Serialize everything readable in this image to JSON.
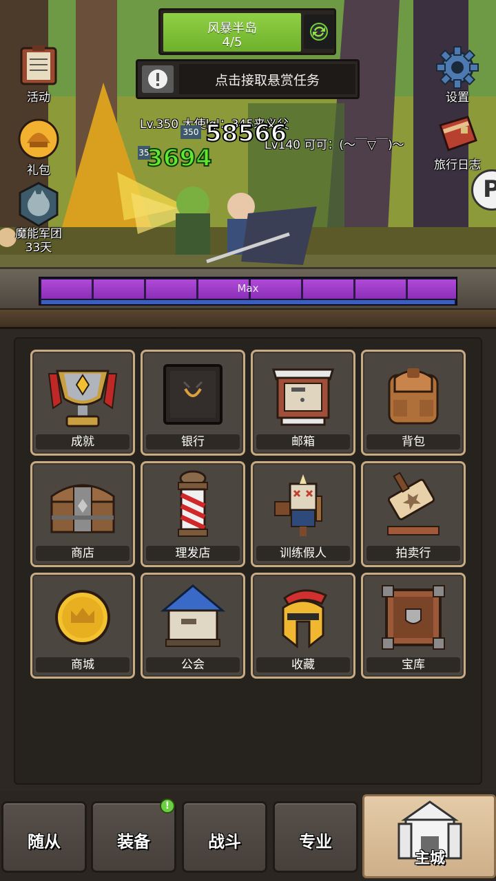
{
  "stage": {
    "name": "风暴半岛",
    "progress": "4/5"
  },
  "quest": {
    "text": "点击接取悬赏任务"
  },
  "left_icons": [
    {
      "label": "活动",
      "icon": "event-board-icon"
    },
    {
      "label": "礼包",
      "icon": "gift-helmet-icon"
    },
    {
      "label": "魔能军团",
      "icon": "wolf-emblem-icon",
      "sub": "33天"
    }
  ],
  "right_icons": [
    {
      "label": "设置",
      "icon": "gear-icon"
    },
    {
      "label": "旅行日志",
      "icon": "journal-book-icon"
    }
  ],
  "floating": {
    "player1": "Lv.350 大使lgl：345来义父",
    "player2": "Lv140 可可：(～￣▽￣)～",
    "level_tag": "350",
    "level_tag2": "35",
    "damage_white": "58566",
    "damage_green": "3694"
  },
  "max_bar": {
    "label": "Max",
    "segments": 8
  },
  "buildings": [
    {
      "label": "成就",
      "icon": "trophy-icon"
    },
    {
      "label": "银行",
      "icon": "safe-icon"
    },
    {
      "label": "邮箱",
      "icon": "mailbox-icon"
    },
    {
      "label": "背包",
      "icon": "backpack-icon"
    },
    {
      "label": "商店",
      "icon": "chest-icon"
    },
    {
      "label": "理发店",
      "icon": "barber-pole-icon"
    },
    {
      "label": "训练假人",
      "icon": "training-dummy-icon"
    },
    {
      "label": "拍卖行",
      "icon": "auction-gavel-icon"
    },
    {
      "label": "商城",
      "icon": "gold-coin-icon"
    },
    {
      "label": "公会",
      "icon": "guild-house-icon"
    },
    {
      "label": "收藏",
      "icon": "spartan-helmet-icon"
    },
    {
      "label": "宝库",
      "icon": "vault-crate-icon"
    }
  ],
  "nav": {
    "followers": "随从",
    "equipment": "装备",
    "equipment_badge": "!",
    "battle": "战斗",
    "profession": "专业",
    "main_city": "主城"
  },
  "colors": {
    "stage_green": "#7fc23a",
    "tile_border": "#c9ab84",
    "max_purple": "#9a3cc8",
    "damage_green": "#5ee832"
  }
}
